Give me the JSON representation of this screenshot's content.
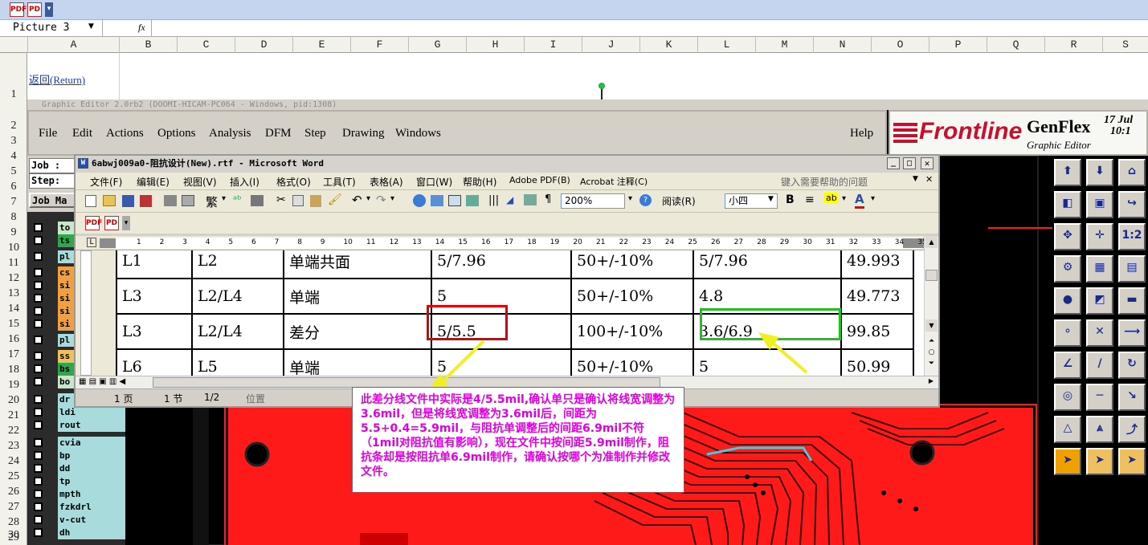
{
  "excel": {
    "name_box": "Picture 3",
    "fx_symbol": "fx",
    "columns": [
      "A",
      "B",
      "C",
      "D",
      "E",
      "F",
      "G",
      "H",
      "I",
      "J",
      "K",
      "L",
      "M",
      "N",
      "O",
      "P",
      "Q",
      "R",
      "S"
    ],
    "rows": [
      "1",
      "2",
      "3",
      "4",
      "5",
      "6",
      "7",
      "8",
      "9",
      "10",
      "11",
      "12",
      "13",
      "14",
      "15",
      "16",
      "17",
      "18",
      "19",
      "20",
      "21",
      "22",
      "23",
      "24",
      "25",
      "26",
      "27",
      "28",
      "29",
      "30"
    ],
    "return_link": "返回(Return)"
  },
  "genflex": {
    "title": "Graphic Editor 2.0rb2 (DOOMI-HICAM-PC064 - Windows, pid:1308)",
    "menu": [
      "File",
      "Edit",
      "Actions",
      "Options",
      "Analysis",
      "DFM",
      "Step",
      "Drawing",
      "Windows"
    ],
    "help": "Help",
    "logo": "Frontline",
    "product": "GenFlex",
    "product_sub": "Graphic Editor",
    "date_line1": "17 Jul",
    "date_line2": "10:1",
    "job_label": "Job :",
    "step_label": "Step:",
    "job_matrix_label": "Job Ma",
    "layers": [
      {
        "name": "to",
        "color": "#c8e6c8"
      },
      {
        "name": "ts",
        "color": "#2ea84a"
      },
      {
        "name": "pl",
        "color": "#a8dcdc"
      },
      {
        "name": "cs",
        "color": "#f0a040"
      },
      {
        "name": "si",
        "color": "#f0a040"
      },
      {
        "name": "si",
        "color": "#f0a040"
      },
      {
        "name": "si",
        "color": "#f0a040"
      },
      {
        "name": "si",
        "color": "#f0a040"
      },
      {
        "name": "pl",
        "color": "#a8dcdc"
      },
      {
        "name": "ss",
        "color": "#f0c060"
      },
      {
        "name": "bs",
        "color": "#2ea84a"
      },
      {
        "name": "bo",
        "color": "#c8e6c8"
      },
      {
        "name": "dr",
        "color": "#a8dcdc"
      },
      {
        "name": "ldi",
        "color": "#a8dcdc"
      },
      {
        "name": "rout",
        "color": "#a8dcdc"
      },
      {
        "name": "cvia",
        "color": "#a8dcdc"
      },
      {
        "name": "bp",
        "color": "#a8dcdc"
      },
      {
        "name": "dd",
        "color": "#a8dcdc"
      },
      {
        "name": "tp",
        "color": "#a8dcdc"
      },
      {
        "name": "mpth",
        "color": "#a8dcdc"
      },
      {
        "name": "fzkdrl",
        "color": "#a8dcdc"
      },
      {
        "name": "v-cut",
        "color": "#a8dcdc"
      },
      {
        "name": "dh",
        "color": "#a8dcdc"
      }
    ]
  },
  "word": {
    "title": "6abwj009a0-阻抗设计(New).rtf - Microsoft Word",
    "menu": [
      "文件(F)",
      "编辑(E)",
      "视图(V)",
      "插入(I)",
      "格式(O)",
      "工具(T)",
      "表格(A)",
      "窗口(W)",
      "帮助(H)",
      "Adobe PDF(B)",
      "Acrobat 注释(C)"
    ],
    "help_box": "键入需要帮助的问题",
    "zoom": "200%",
    "read_label": "阅读(R)",
    "font_size": "小四",
    "ruler_numbers": [
      "1",
      "2",
      "3",
      "4",
      "5",
      "6",
      "7",
      "8",
      "9",
      "10",
      "11",
      "12",
      "13",
      "14",
      "15",
      "16",
      "17",
      "18",
      "19",
      "20",
      "21",
      "22",
      "23",
      "24",
      "25",
      "26",
      "27",
      "28",
      "29",
      "30",
      "31",
      "32",
      "33",
      "34",
      "35"
    ],
    "status": {
      "page": "1 页",
      "section": "1 节",
      "ratio": "1/2",
      "position": "位置"
    },
    "table": [
      [
        "L1",
        "L2",
        "单端共面",
        "5/7.96",
        "50+/-10%",
        "5/7.96",
        "49.993"
      ],
      [
        "L3",
        "L2/L4",
        "单端",
        "5",
        "50+/-10%",
        "4.8",
        "49.773"
      ],
      [
        "L3",
        "L2/L4",
        "差分",
        "5/5.5",
        "100+/-10%",
        "3.6/6.9",
        "99.85"
      ],
      [
        "L6",
        "L5",
        "单端",
        "5",
        "50+/-10%",
        "5",
        "50.99"
      ]
    ]
  },
  "annotation": {
    "text": "此差分线文件中实际是4/5.5mil,确认单只是确认将线宽调整为3.6mil，但是将线宽调整为3.6mil后，间距为5.5+0.4=5.9mil，与阻抗单调整后的间距6.9mil不符（1mil对阻抗值有影响），现在文件中按间距5.9mil制作，阻抗条却是按阻抗单6.9mil制作，请确认按哪个为准制作并修改文件。"
  },
  "colors": {
    "pcb_red": "#ff1a1a",
    "highlight_red": "#e00000",
    "highlight_green": "#22c022",
    "arrow_yellow": "#f0f020",
    "note_text": "#e000e0"
  }
}
